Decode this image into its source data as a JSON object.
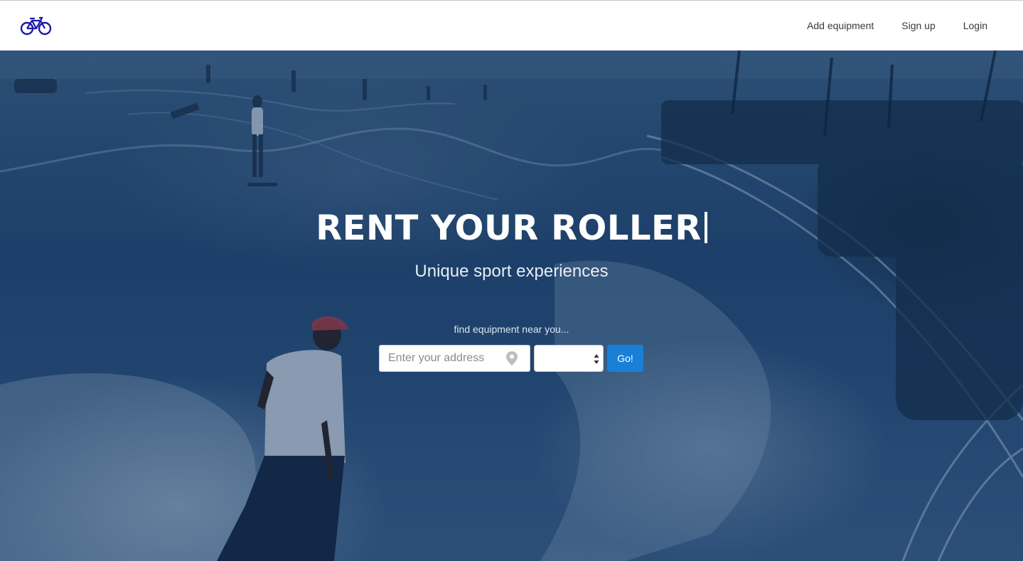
{
  "brand": {
    "logo_icon": "bicycle-icon",
    "accent_color": "#1a1aa8"
  },
  "nav": {
    "items": [
      {
        "label": "Add equipment"
      },
      {
        "label": "Sign up"
      },
      {
        "label": "Login"
      }
    ]
  },
  "hero": {
    "title": "RENT YOUR ROLLER",
    "subtitle": "Unique sport experiences",
    "background": "skatepark-photo"
  },
  "search": {
    "hint": "find equipment near you...",
    "address_placeholder": "Enter your address",
    "address_value": "",
    "address_icon": "map-pin-icon",
    "category_selected": "",
    "submit_label": "Go!",
    "submit_color": "#1a7fd6"
  }
}
